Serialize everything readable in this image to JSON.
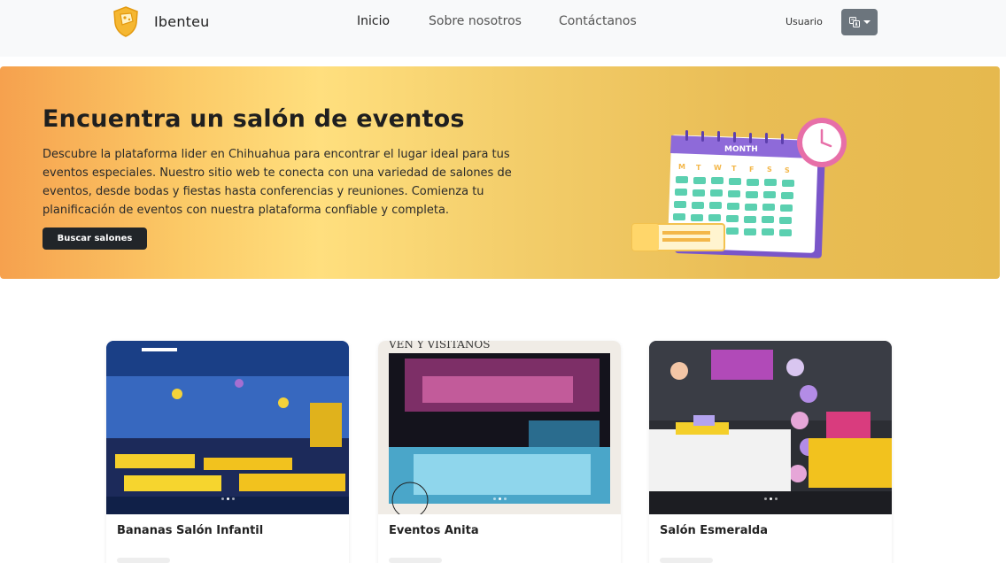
{
  "brand": {
    "name": "Ibenteu",
    "logo_icon": "cheese-shield-icon"
  },
  "nav": {
    "links": [
      {
        "label": "Inicio",
        "active": true
      },
      {
        "label": "Sobre nosotros",
        "active": false
      },
      {
        "label": "Contáctanos",
        "active": false
      }
    ],
    "user_label": "Usuario",
    "language_icon": "translate-icon"
  },
  "hero": {
    "title": "Encuentra un salón de eventos",
    "description": "Descubre la plataforma lider en Chihuahua para encontrar el lugar ideal para tus eventos especiales. Nuestro sitio web te conecta con una variedad de salones de eventos, desde bodas y fiestas hasta conferencias y reuniones. Comienza tu planificación de eventos con nuestra plataforma confiable y completa.",
    "button_label": "Buscar salones",
    "illustration": {
      "calendar_header": "MONTH",
      "weekdays": [
        "M",
        "T",
        "W",
        "T",
        "F",
        "S",
        "S"
      ]
    }
  },
  "cards": [
    {
      "title": "Bananas Salón Infantil",
      "image_icon": "party-hall-photo"
    },
    {
      "title": "Eventos Anita",
      "image_icon": "event-hall-photo",
      "image_caption": "VEN Y VISÍTANOS"
    },
    {
      "title": "Salón Esmeralda",
      "image_icon": "birthday-party-photo"
    }
  ],
  "colors": {
    "navbar_bg": "#f8f9fa",
    "hero_start": "#f6a14e",
    "hero_mid": "#ffdf7e",
    "hero_end": "#e6b94e",
    "button_dark": "#212529",
    "lang_button": "#6c757d"
  }
}
